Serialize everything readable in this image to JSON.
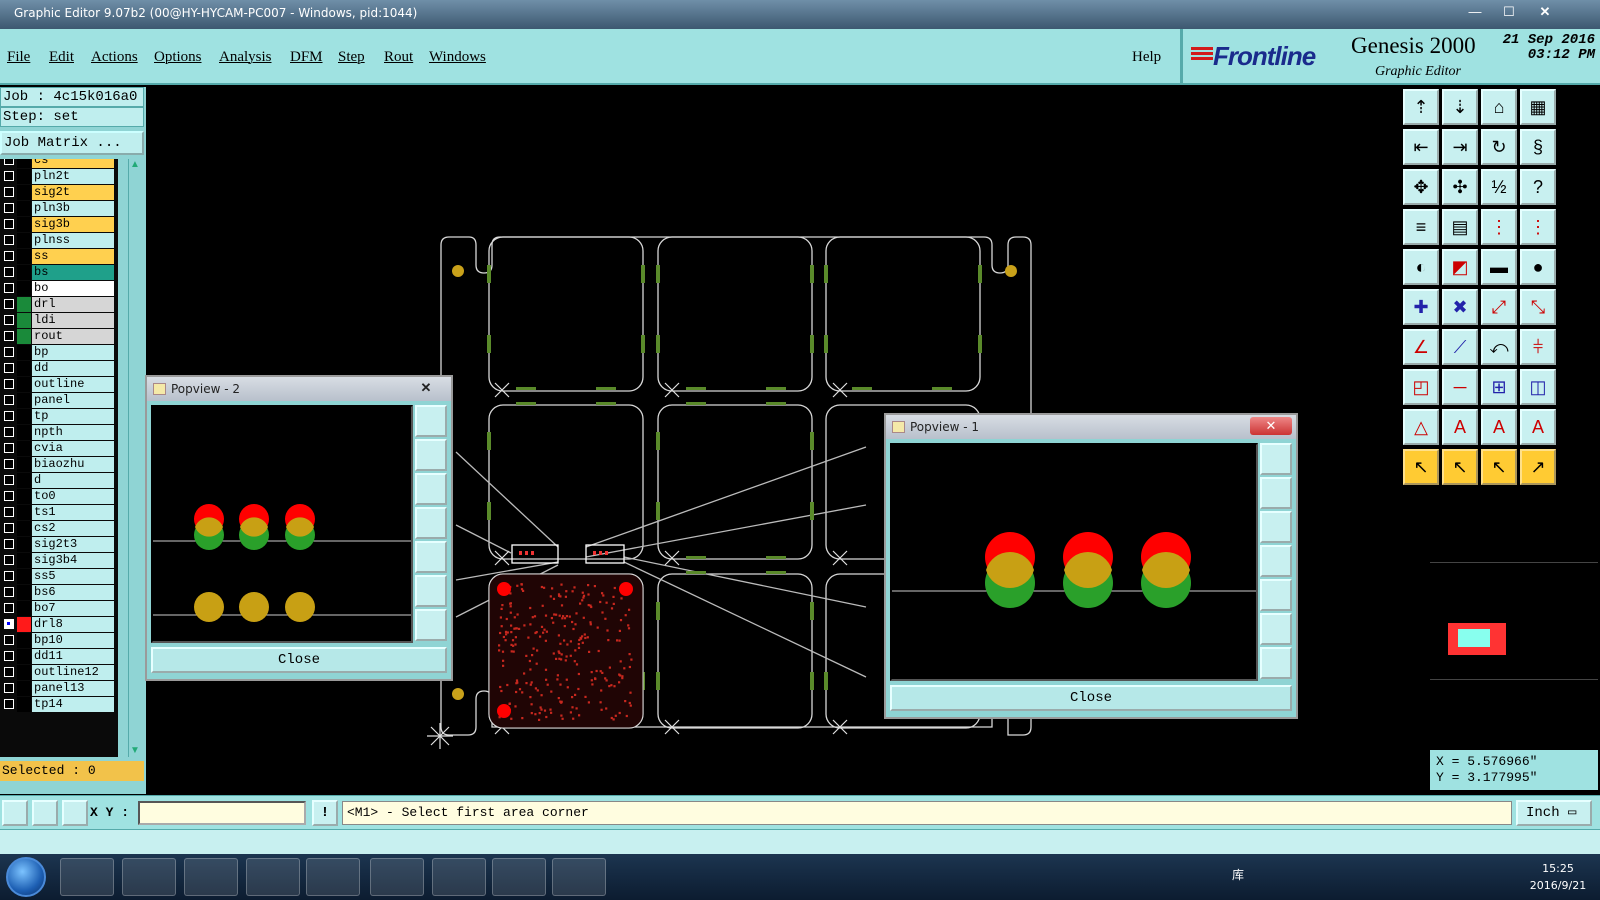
{
  "window": {
    "title": "Graphic Editor 9.07b2 (00@HY-HYCAM-PC007 - Windows, pid:1044)"
  },
  "menu": [
    "File",
    "Edit",
    "Actions",
    "Options",
    "Analysis",
    "DFM",
    "Step",
    "Rout",
    "Windows"
  ],
  "help_label": "Help",
  "brand": {
    "logo": "Frontline",
    "product": "Genesis 2000",
    "subtitle": "Graphic Editor",
    "date_line1": "21 Sep 2016",
    "date_line2": "03:12 PM"
  },
  "job": {
    "job_line": "Job : 4c15k016a0",
    "step_line": "Step: set",
    "job_matrix": "Job Matrix ..."
  },
  "layers": [
    {
      "name": "cs",
      "color": "#ffd04f",
      "active": false
    },
    {
      "name": "pln2t",
      "color": "#bfeeee",
      "active": false
    },
    {
      "name": "sig2t",
      "color": "#ffd04f",
      "active": false
    },
    {
      "name": "pln3b",
      "color": "#bfeeee",
      "active": false
    },
    {
      "name": "sig3b",
      "color": "#ffd04f",
      "active": false
    },
    {
      "name": "plnss",
      "color": "#bfeeee",
      "active": false
    },
    {
      "name": "ss",
      "color": "#ffd04f",
      "active": false
    },
    {
      "name": "bs",
      "color": "#1fa08a",
      "active": false
    },
    {
      "name": "bo",
      "color": "#ffffff",
      "active": false
    },
    {
      "name": "drl",
      "color": "#d6d6d6",
      "active": false
    },
    {
      "name": "ldi",
      "color": "#d6d6d6",
      "active": false
    },
    {
      "name": "rout",
      "color": "#d6d6d6",
      "active": false
    },
    {
      "name": "bp",
      "color": "#bfeeee",
      "active": false
    },
    {
      "name": "dd",
      "color": "#bfeeee",
      "active": false
    },
    {
      "name": "outline",
      "color": "#bfeeee",
      "active": false
    },
    {
      "name": "panel",
      "color": "#bfeeee",
      "active": false
    },
    {
      "name": "tp",
      "color": "#bfeeee",
      "active": false
    },
    {
      "name": "npth",
      "color": "#bfeeee",
      "active": false
    },
    {
      "name": "cvia",
      "color": "#bfeeee",
      "active": false
    },
    {
      "name": "biaozhu",
      "color": "#bfeeee",
      "active": false
    },
    {
      "name": "d",
      "color": "#bfeeee",
      "active": false
    },
    {
      "name": "to0",
      "color": "#bfeeee",
      "active": false
    },
    {
      "name": "ts1",
      "color": "#bfeeee",
      "active": false
    },
    {
      "name": "cs2",
      "color": "#bfeeee",
      "active": false
    },
    {
      "name": "sig2t3",
      "color": "#bfeeee",
      "active": false
    },
    {
      "name": "sig3b4",
      "color": "#bfeeee",
      "active": false
    },
    {
      "name": "ss5",
      "color": "#bfeeee",
      "active": false
    },
    {
      "name": "bs6",
      "color": "#bfeeee",
      "active": false
    },
    {
      "name": "bo7",
      "color": "#bfeeee",
      "active": false
    },
    {
      "name": "drl8",
      "color": "#bfeeee",
      "active": true
    },
    {
      "name": "bp10",
      "color": "#bfeeee",
      "active": false
    },
    {
      "name": "dd11",
      "color": "#bfeeee",
      "active": false
    },
    {
      "name": "outline12",
      "color": "#bfeeee",
      "active": false
    },
    {
      "name": "panel13",
      "color": "#bfeeee",
      "active": false
    },
    {
      "name": "tp14",
      "color": "#bfeeee",
      "active": false
    }
  ],
  "selected": "Selected : 0",
  "popview2": {
    "title": "Popview - 2",
    "close": "Close"
  },
  "popview1": {
    "title": "Popview - 1",
    "close": "Close"
  },
  "coords": {
    "x": "X = 5.576966\"",
    "y": "Y = 3.177995\""
  },
  "status": {
    "xy_label": "X Y :",
    "xy_value": "",
    "excl": "!",
    "prompt": "<M1> - Select first area corner",
    "unit": "Inch"
  },
  "taskbar": {
    "tray_text": "库",
    "time": "15:25",
    "date": "2016/9/21"
  }
}
